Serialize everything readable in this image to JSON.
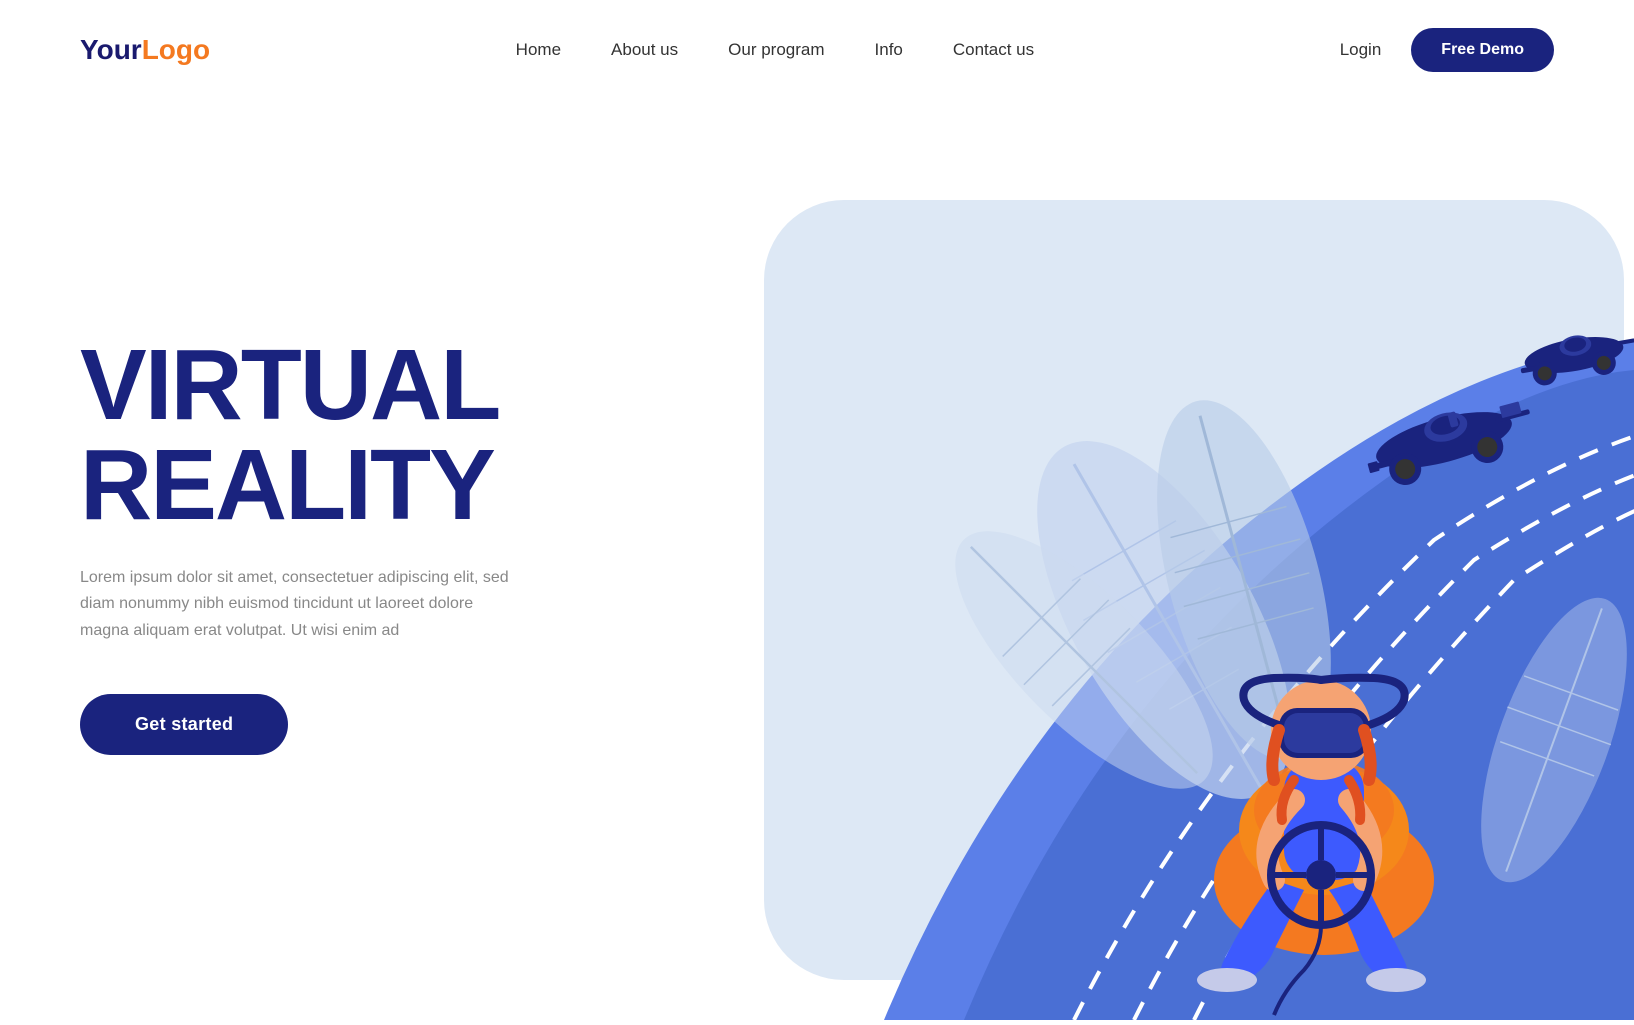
{
  "logo": {
    "your": "Your",
    "logo": "Logo"
  },
  "nav": {
    "items": [
      {
        "label": "Home",
        "href": "#"
      },
      {
        "label": "About us",
        "href": "#"
      },
      {
        "label": "Our program",
        "href": "#"
      },
      {
        "label": "Info",
        "href": "#"
      },
      {
        "label": "Contact us",
        "href": "#"
      }
    ]
  },
  "header_actions": {
    "login": "Login",
    "free_demo": "Free Demo"
  },
  "hero": {
    "title_line1": "VIRTUAL",
    "title_line2": "REALITY",
    "description": "Lorem ipsum dolor sit amet, consectetuer adipiscing elit, sed diam nonummy nibh euismod tincidunt ut laoreet dolore magna aliquam erat volutpat. Ut wisi enim ad",
    "cta": "Get started"
  },
  "colors": {
    "dark_blue": "#1a237e",
    "orange": "#f47920",
    "light_blue": "#c5cdf0",
    "lighter_blue": "#dde3f7",
    "bg_blue": "#3d5afe",
    "road_blue": "#5c7cfa"
  }
}
